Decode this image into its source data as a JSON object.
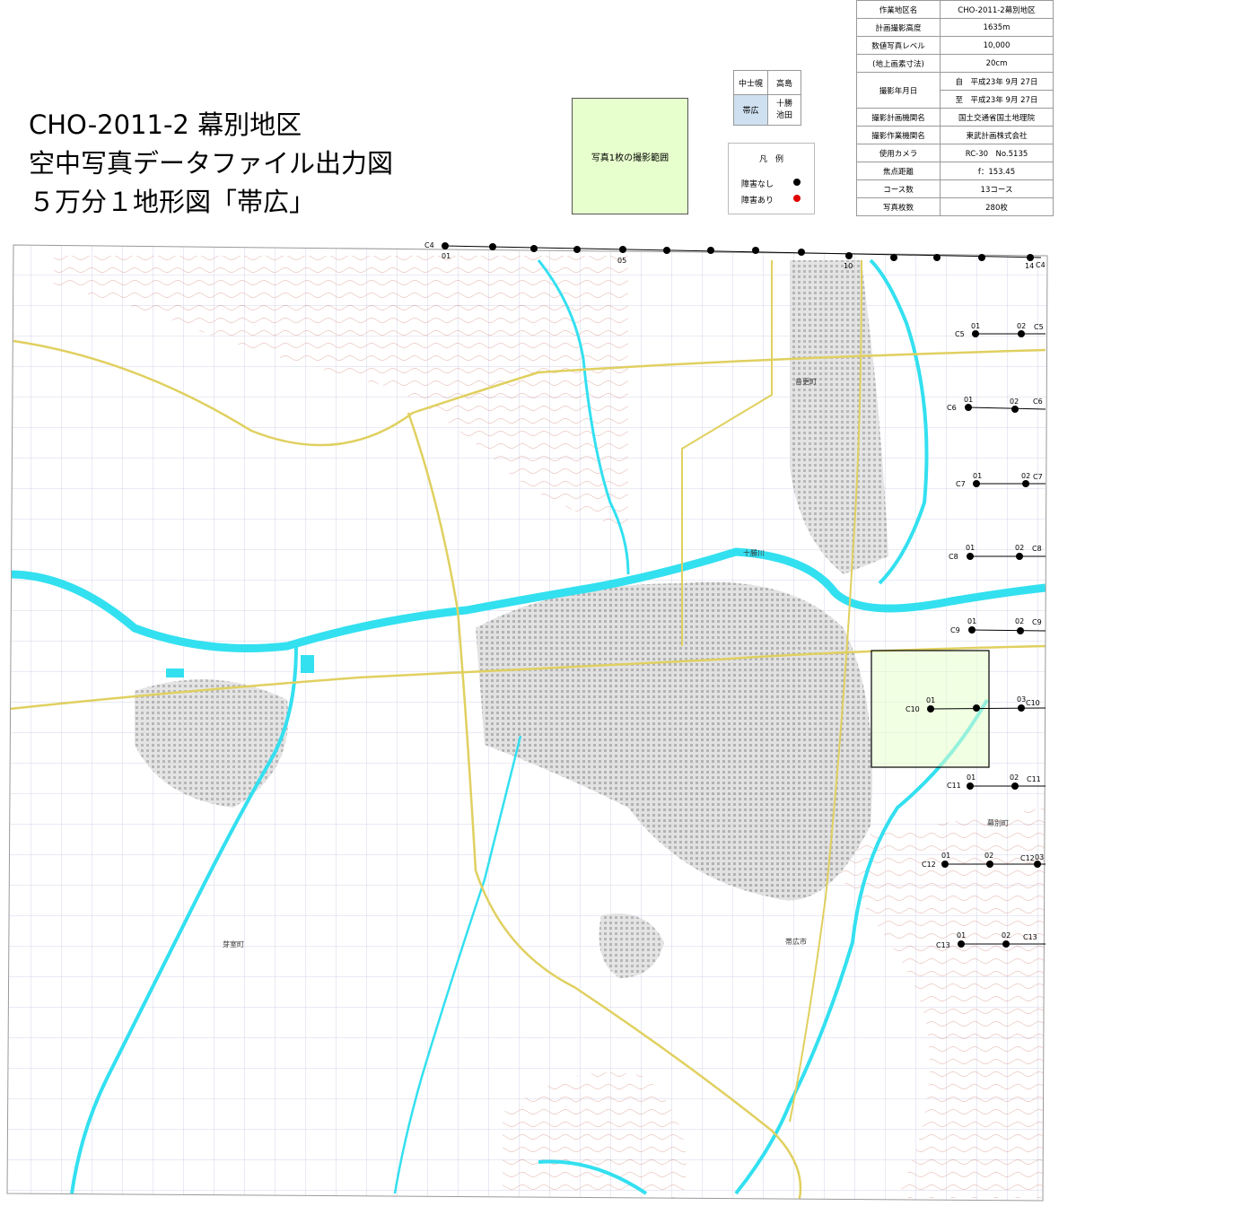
{
  "title": {
    "line1": "CHO-2011-2 幕別地区",
    "line2": "空中写真データファイル出力図",
    "line3": "５万分１地形図「帯広」"
  },
  "extent_box": {
    "label": "写真1枚の撮影範囲",
    "color": "#e6ffcc"
  },
  "sheet_index": {
    "cells": [
      "中士幌",
      "高島",
      "帯広",
      "十勝\n池田"
    ],
    "highlight_color": "#cfe0f0"
  },
  "legend": {
    "title": "凡　例",
    "items": [
      {
        "label": "障害なし",
        "color": "#000000"
      },
      {
        "label": "障害あり",
        "color": "#e00000"
      }
    ]
  },
  "info_table": [
    {
      "key": "作業地区名",
      "value": "CHO-2011-2幕別地区"
    },
    {
      "key": "計画撮影高度",
      "value": "1635m"
    },
    {
      "key": "数値写真レベル",
      "value": "10,000"
    },
    {
      "key": "(地上画素寸法)",
      "value": "20cm"
    },
    {
      "key": "撮影年月日",
      "value": "自　平成23年 9月 27日",
      "value2": "至　平成23年 9月 27日"
    },
    {
      "key": "撮影計画機関名",
      "value": "国土交通省国土地理院"
    },
    {
      "key": "撮影作業機関名",
      "value": "東武計画株式会社"
    },
    {
      "key": "使用カメラ",
      "value": "RC-30　No.5135"
    },
    {
      "key": "焦点距離",
      "value": "f：153.45"
    },
    {
      "key": "コース数",
      "value": "13コース"
    },
    {
      "key": "写真枚数",
      "value": "280枚"
    }
  ],
  "map": {
    "colors": {
      "river": "#33e0f0",
      "road": "#e0d060",
      "contour": "#d08070",
      "grid": "#8888cc",
      "urban": "#c8c8c8"
    },
    "places": [
      "十勝川",
      "帯広市",
      "音更町",
      "幕別町",
      "芽室町"
    ],
    "courses": [
      {
        "id": "C4",
        "first": "01",
        "mid": "05",
        "mid2": "10",
        "last": "14",
        "end": "C4"
      },
      {
        "id": "C5",
        "first": "01",
        "last": "02",
        "end": "C5"
      },
      {
        "id": "C6",
        "first": "01",
        "last": "02",
        "end": "C6"
      },
      {
        "id": "C7",
        "first": "01",
        "last": "02",
        "end": "C7"
      },
      {
        "id": "C8",
        "first": "01",
        "last": "02",
        "end": "C8"
      },
      {
        "id": "C9",
        "first": "01",
        "last": "02",
        "end": "C9"
      },
      {
        "id": "C10",
        "first": "01",
        "last": "03",
        "end": "C10"
      },
      {
        "id": "C11",
        "first": "01",
        "last": "02",
        "end": "C11"
      },
      {
        "id": "C12",
        "first": "01",
        "last": "02",
        "end": "C12",
        "extra": "03"
      },
      {
        "id": "C13",
        "first": "01",
        "last": "02",
        "end": "C13"
      }
    ]
  }
}
